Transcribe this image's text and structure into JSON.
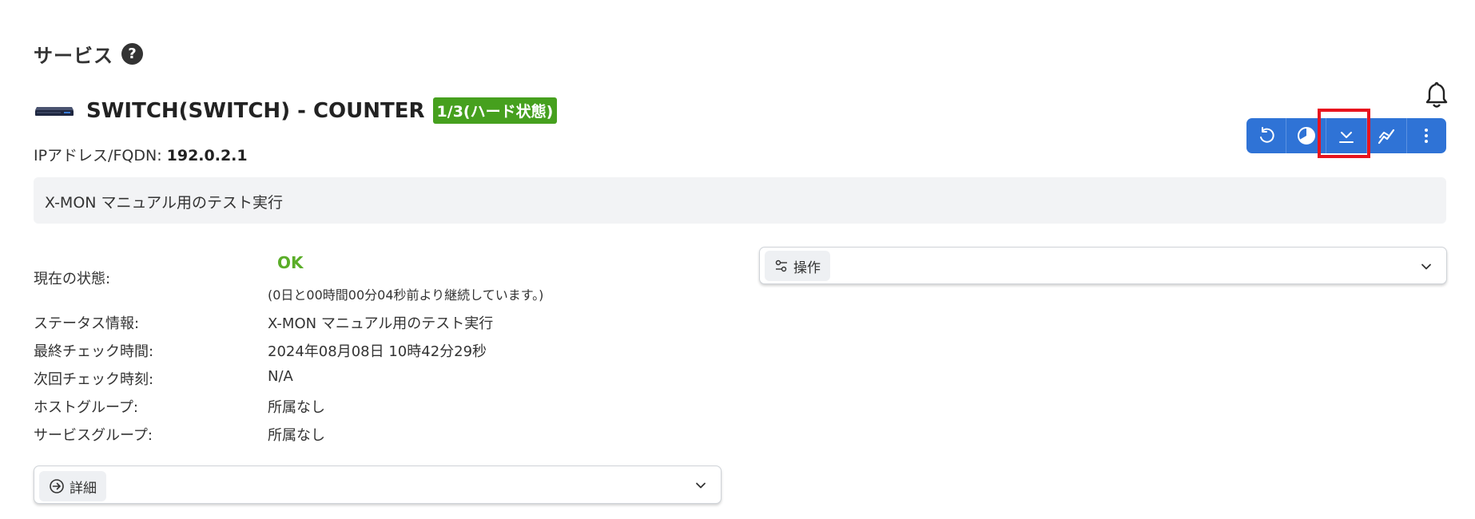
{
  "page": {
    "heading": "サービス",
    "help_icon": "question-circle-icon"
  },
  "service": {
    "device_icon": "network-switch-icon",
    "title": "SWITCH(SWITCH) - COUNTER",
    "state_badge": "1/3(ハード状態)",
    "ip_label": "IPアドレス/FQDN: ",
    "ip_value": "192.0.2.1",
    "description": "X-MON マニュアル用のテスト実行"
  },
  "toolbar": {
    "buttons": [
      {
        "icon": "refresh-icon"
      },
      {
        "icon": "history-pie-icon"
      },
      {
        "icon": "download-icon"
      },
      {
        "icon": "graph-icon"
      },
      {
        "icon": "more-vertical-icon"
      }
    ],
    "highlighted_index": 2
  },
  "status": {
    "current_label": "現在の状態:",
    "current_value": "OK",
    "elapsed": "(0日と00時間00分04秒前より継続しています。)",
    "rows": [
      {
        "label": "ステータス情報:",
        "value": "X-MON マニュアル用のテスト実行"
      },
      {
        "label": "最終チェック時間:",
        "value": "2024年08月08日 10時42分29秒"
      },
      {
        "label": "次回チェック時刻:",
        "value": "N/A"
      },
      {
        "label": "ホストグループ:",
        "value": "所属なし"
      },
      {
        "label": "サービスグループ:",
        "value": "所属なし"
      }
    ]
  },
  "operations": {
    "label": "操作"
  },
  "details": {
    "label": "詳細"
  },
  "colors": {
    "accent": "#2f73d6",
    "ok": "#5aad28",
    "badge": "#46a01e",
    "highlight": "#e8141e"
  }
}
